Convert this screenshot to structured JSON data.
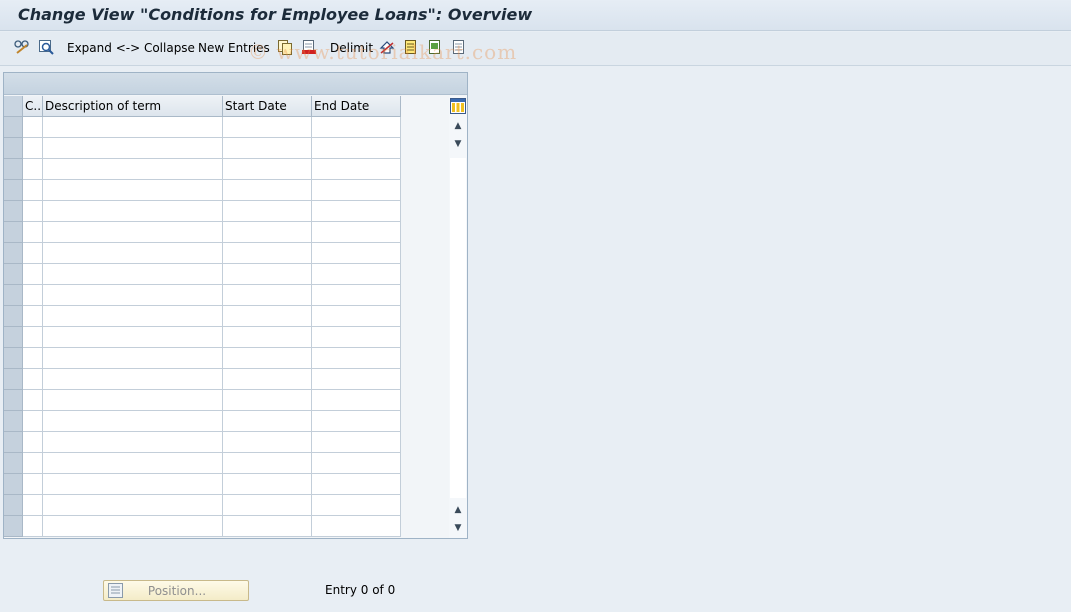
{
  "window": {
    "title": "Change View \"Conditions for Employee Loans\": Overview"
  },
  "toolbar": {
    "expand_collapse_label": "Expand <-> Collapse",
    "new_entries_label": "New Entries",
    "delimit_label": "Delimit",
    "icons": [
      "pen-glasses-icon",
      "details-icon",
      "copy-icon",
      "delete-icon",
      "undo-icon",
      "select-all-icon",
      "select-block-icon",
      "deselect-all-icon"
    ]
  },
  "watermark": "© www.tutorialkart.com",
  "table": {
    "columns": [
      {
        "key": "c",
        "label": "C.."
      },
      {
        "key": "description",
        "label": "Description of term"
      },
      {
        "key": "start_date",
        "label": "Start Date"
      },
      {
        "key": "end_date",
        "label": "End Date"
      }
    ],
    "rows": [],
    "visible_empty_rows": 20
  },
  "footer": {
    "position_button_label": "Position...",
    "entry_info": "Entry 0 of 0"
  },
  "colors": {
    "background": "#e8eef4",
    "title_text": "#1c2b3a",
    "row_selector": "#c5d1dd"
  }
}
